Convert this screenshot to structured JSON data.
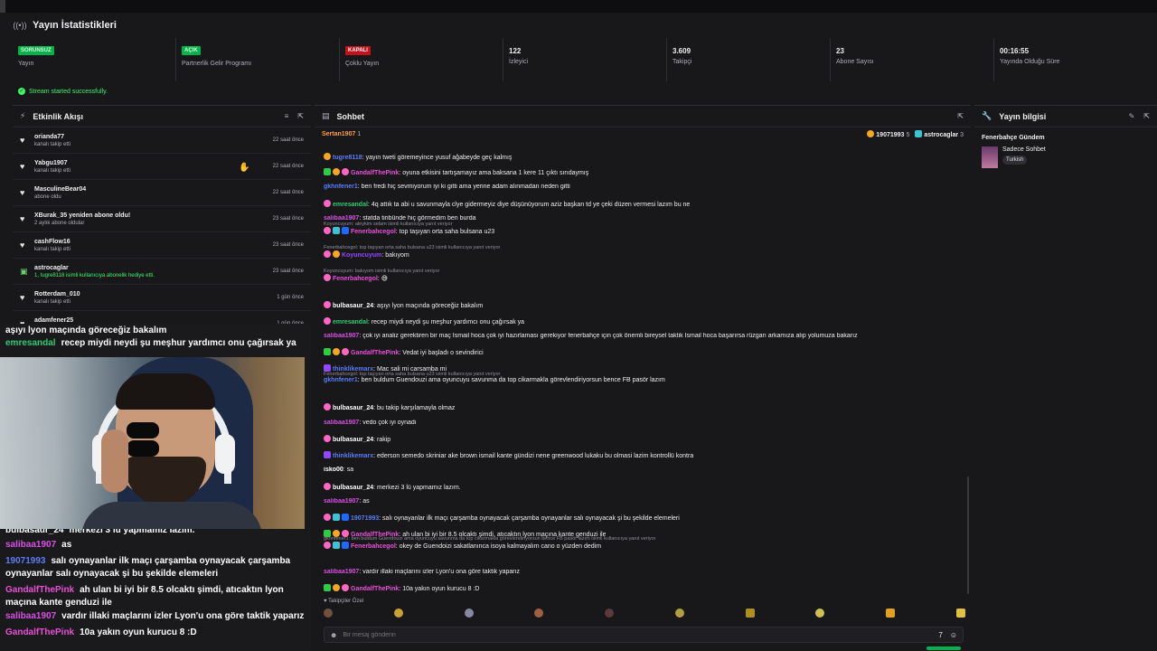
{
  "header": {
    "title": "Yayın İstatistikleri"
  },
  "stats": [
    {
      "badge": "SORUNSUZ",
      "badge_color": "green",
      "label": "Yayın"
    },
    {
      "badge": "AÇIK",
      "badge_color": "green",
      "label": "Partnerlik Gelir Programı"
    },
    {
      "badge": "KAPALI",
      "badge_color": "red",
      "label": "Çoklu Yayın"
    },
    {
      "value": "122",
      "label": "İzleyici"
    },
    {
      "value": "3.609",
      "label": "Takipçi"
    },
    {
      "value": "23",
      "label": "Abone Sayısı"
    },
    {
      "value": "00:16:55",
      "label": "Yayında Olduğu Süre"
    }
  ],
  "status": {
    "message": "Stream started successfully."
  },
  "activity": {
    "title": "Etkinlik Akışı",
    "items": [
      {
        "name": "orianda77",
        "sub": "kanalı takip etti",
        "time": "22 saat önce",
        "type": "follow"
      },
      {
        "name": "Yabgu1907",
        "sub": "kanalı takip etti",
        "time": "22 saat önce",
        "type": "follow"
      },
      {
        "name": "MasculineBear04",
        "sub": "abone oldu",
        "time": "22 saat önce",
        "type": "follow"
      },
      {
        "name": "XBurak_35 yeniden abone oldu!",
        "sub": "2 aylık abone oldular",
        "time": "23 saat önce",
        "type": "follow"
      },
      {
        "name": "cashFlow16",
        "sub": "kanalı takip etti",
        "time": "23 saat önce",
        "type": "follow"
      },
      {
        "name": "astrocaglar",
        "sub": "1, tugre8118 isimli kullanıcıya abonelik hediye etti.",
        "time": "23 saat önce",
        "type": "gift"
      },
      {
        "name": "Rotterdam_010",
        "sub": "kanalı takip etti",
        "time": "1 gün önce",
        "type": "follow"
      },
      {
        "name": "adamfener25",
        "sub": "kanalı takip etti",
        "time": "1 gün önce",
        "type": "follow"
      }
    ]
  },
  "overlay_chat": [
    {
      "user": "",
      "text": "aşıyı lyon maçında göreceğiz bakalım",
      "color": "#ffffff"
    },
    {
      "user": "emresandal",
      "text": "recep miydi neydi şu meşhur yardımcı onu çağırsak ya",
      "color": "#2ecc71"
    },
    {
      "user": "bulbasaur_24",
      "text": "merkezi 3 lü yapmamız lazım.",
      "color": "#ffffff"
    },
    {
      "user": "salibaa1907",
      "text": "as",
      "color": "#d94fe6"
    },
    {
      "user": "19071993",
      "text": "salı oynayanlar ilk maçı çarşamba oynayacak çarşamba oynayanlar salı oynayacak şi bu şekilde elemeleri",
      "color": "#5b7cf5"
    },
    {
      "user": "GandalfThePink",
      "text": "ah ulan bi iyi bir 8.5 olcaktı şimdi, atıcaktın lyon maçına kante genduzi ile",
      "color": "#e94fd6"
    },
    {
      "user": "salibaa1907",
      "text": "vardır illaki maçlarını izler Lyon'u ona göre taktik yaparız",
      "color": "#d94fe6"
    },
    {
      "user": "GandalfThePink",
      "text": "10a yakın oyun kurucu 8 :D",
      "color": "#e94fd6"
    }
  ],
  "chat": {
    "title": "Sohbet",
    "pinned_user": "Sertan1907",
    "pinned_count": "1",
    "top": [
      {
        "name": "19071993",
        "count": "5"
      },
      {
        "name": "astrocaglar",
        "count": "3"
      }
    ],
    "messages": [
      {
        "user": "tugre8118",
        "color": "#5b7cf5",
        "text": "yayın tweti göremeyince yusuf ağabeyde geç kalmış",
        "badges": [
          "gold"
        ]
      },
      {
        "user": "GandalfThePink",
        "color": "#e94fd6",
        "text": "oyuna etkisini tartışamayız ama baksana 1 kere 11 çıktı sırıdaymış",
        "badges": [
          "mod",
          "gold",
          "sub"
        ]
      },
      {
        "user": "gkhnfener1",
        "color": "#5b7cf5",
        "text": "ben fredi hiç sevmiyorum iyi ki gitti ama yerine adam alınmadan neden gitti",
        "badges": []
      },
      {
        "user": "emresandal",
        "color": "#2ecc71",
        "text": "4q attık ta abi u savunmayla clye gidermeyiz diye düşünüyorum aziz başkan td ye çeki düzen vermesi lazım bu ne",
        "badges": [
          "sub"
        ]
      },
      {
        "user": "salibaa1907",
        "color": "#d94fe6",
        "text": "statda tiribünde hiç görmedim ben burda",
        "badges": []
      },
      {
        "reply": "Koyuncuyum: aleykim selam isimli kullanıcıya yanıt veriyor",
        "user": "Fenerbahcegol",
        "color": "#e94fd6",
        "text": "top taşıyan orta saha bulsana u23",
        "badges": [
          "sub",
          "cyan",
          "blue"
        ]
      },
      {
        "reply": "Fenerbahcegol: top taşıyan orta saha bulsana u23 isimli kullanıcıya yanıt veriyor",
        "user": "Koyuncuyum",
        "color": "#9146ff",
        "text": "bakıyom",
        "badges": [
          "sub",
          "gold"
        ]
      },
      {
        "reply": "Koyuncuyum: bakıyom isimli kullanıcıya yanıt veriyor",
        "user": "Fenerbahcegol",
        "color": "#e94fd6",
        "text": "😅",
        "badges": [
          "sub"
        ]
      },
      {
        "user": "bulbasaur_24",
        "color": "#ffffff",
        "text": "aşıyı lyon maçında göreceğiz bakalım",
        "badges": [
          "sub"
        ]
      },
      {
        "user": "emresandal",
        "color": "#2ecc71",
        "text": "recep miydi neydi şu meşhur yardımcı onu çağırsak ya",
        "badges": [
          "sub"
        ]
      },
      {
        "user": "salibaa1907",
        "color": "#d94fe6",
        "text": "çok iyi analiz gerektiren bir maç İsmail hoca çok iyi hazırlaması gerekiyor fenerbahçe için çok önemli bireysel taktik İsmail hoca başarırsa rüzgarı arkamıza alıp yolumuza bakarız",
        "badges": []
      },
      {
        "user": "GandalfThePink",
        "color": "#e94fd6",
        "text": "Vedat iyi başladı o sevindirici",
        "badges": [
          "mod",
          "gold",
          "sub"
        ]
      },
      {
        "user": "thinklikemarx",
        "color": "#5b7cf5",
        "text": "Mac sali mi carsamba mi",
        "badges": [
          "prime"
        ]
      },
      {
        "reply": "Fenerbahcegol: top taşıyan orta saha bulsana u23 isimli kullanıcıya yanıt veriyor",
        "user": "gkhnfener1",
        "color": "#5b7cf5",
        "text": "ben buldum Guendouzi ama oyuncuyu savunma da top cikarmakla görevlendiriyorsun bence FB pasör lazım",
        "badges": []
      },
      {
        "user": "bulbasaur_24",
        "color": "#ffffff",
        "text": "bu takip karşılamayla olmaz",
        "badges": [
          "sub"
        ]
      },
      {
        "user": "salibaa1907",
        "color": "#d94fe6",
        "text": "vedo çok iyi oynadı",
        "badges": []
      },
      {
        "user": "bulbasaur_24",
        "color": "#ffffff",
        "text": "rakip",
        "badges": [
          "sub"
        ]
      },
      {
        "user": "thinklikemarx",
        "color": "#5b7cf5",
        "text": "ederson semedo skriniar ake brown ismail kante gündizi nene greenwood lukaku bu olmasi lazim kontrollü kontra",
        "badges": [
          "prime"
        ]
      },
      {
        "user": "isko00",
        "color": "#ffffff",
        "text": "sa",
        "badges": []
      },
      {
        "user": "bulbasaur_24",
        "color": "#ffffff",
        "text": "merkezi 3 lü yapmamız lazım.",
        "badges": [
          "sub"
        ]
      },
      {
        "user": "salibaa1907",
        "color": "#d94fe6",
        "text": "as",
        "badges": []
      },
      {
        "user": "19071993",
        "color": "#5b7cf5",
        "text": "salı oynayanlar ilk maçı çarşamba oynayacak çarşamba oynayanlar salı oynayacak şi bu şekilde elemeleri",
        "badges": [
          "sub",
          "cyan",
          "blue"
        ]
      },
      {
        "user": "GandalfThePink",
        "color": "#e94fd6",
        "text": "ah ulan bi iyi bir 8.5 olcaktı şimdi, atıcaktın lyon maçına kante genduzi ile",
        "badges": [
          "mod",
          "gold",
          "sub"
        ]
      },
      {
        "reply": "gkhnfener1: ben buldum Guendouzi ama oyuncuyu savunma da top cikarmakla görevlendiriyorsun bence FB pasör lazım isimli kullanıcıya yanıt veriyor",
        "user": "Fenerbahcegol",
        "color": "#e94fd6",
        "text": "okey de Guendoizi sakatlanınca isoya kalmayalım cano o yüzden dedim",
        "badges": [
          "sub",
          "cyan",
          "blue"
        ]
      },
      {
        "user": "salibaa1907",
        "color": "#d94fe6",
        "text": "vardır illaki maçlarını izler Lyon'u ona göre taktik yaparız",
        "badges": []
      },
      {
        "user": "GandalfThePink",
        "color": "#e94fd6",
        "text": "10a yakın oyun kurucu 8 :D",
        "badges": [
          "mod",
          "gold",
          "sub"
        ]
      }
    ],
    "follow_label": "Takipçiler Özel",
    "input_placeholder": "Bir mesaj gönderin"
  },
  "info": {
    "title": "Yayın bilgisi",
    "stream_title": "Fenerbahçe Gündem",
    "category": "Sadece Sohbet",
    "tag": "Turkish"
  }
}
